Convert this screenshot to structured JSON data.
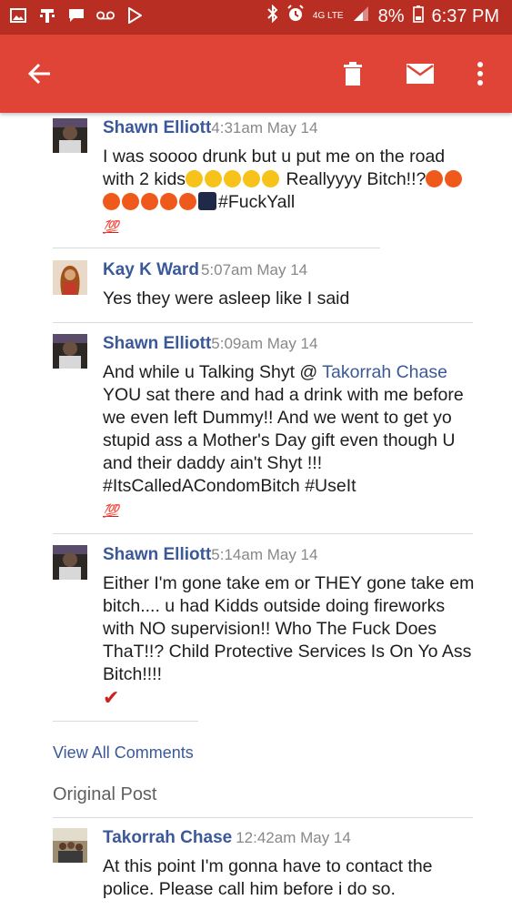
{
  "status_bar": {
    "battery": "8%",
    "time": "6:37 PM",
    "network": "4G LTE"
  },
  "app_bar": {
    "icons": [
      "back-arrow-icon",
      "delete-icon",
      "mail-icon",
      "more-vert-icon"
    ]
  },
  "comments": [
    {
      "author": "Shawn Elliott",
      "time": "4:31am May 14",
      "text_a": "I was soooo drunk but u put me on the road with 2 kids",
      "text_b": " Reallyyyy Bitch!!?",
      "text_c": "#FuckYall",
      "reaction": "💯"
    },
    {
      "author": "Kay K Ward",
      "time": "5:07am May 14",
      "text": "Yes they were asleep like I said"
    },
    {
      "author": "Shawn Elliott",
      "time": "5:09am May 14",
      "text_pre": "And while u Talking Shyt @ ",
      "mention": "Takorrah Chase",
      "text_post": " YOU sat there and had a drink with me before we even left Dummy!! And we went to get yo stupid ass a Mother's Day gift even though U and their daddy ain't Shyt !!! #ItsCalledACondomBitch #UseIt",
      "reaction": "💯"
    },
    {
      "author": "Shawn Elliott",
      "time": "5:14am May 14",
      "text": "Either I'm gone take em or THEY gone take em bitch.... u had Kidds outside doing fireworks with NO supervision!! Who The Fuck Does ThaT!!? Child Protective Services Is On Yo Ass Bitch!!!!",
      "reaction": "✔"
    }
  ],
  "view_all_comments": "View All Comments",
  "original_post": {
    "heading": "Original Post",
    "author": "Takorrah Chase",
    "time": "12:42am May 14",
    "text": "At this point I'm gonna have to contact the police. Please call him before i do so."
  },
  "colors": {
    "status_bar": "#b82e22",
    "app_bar": "#df4437",
    "author": "#3b5998",
    "meta": "#888888"
  }
}
